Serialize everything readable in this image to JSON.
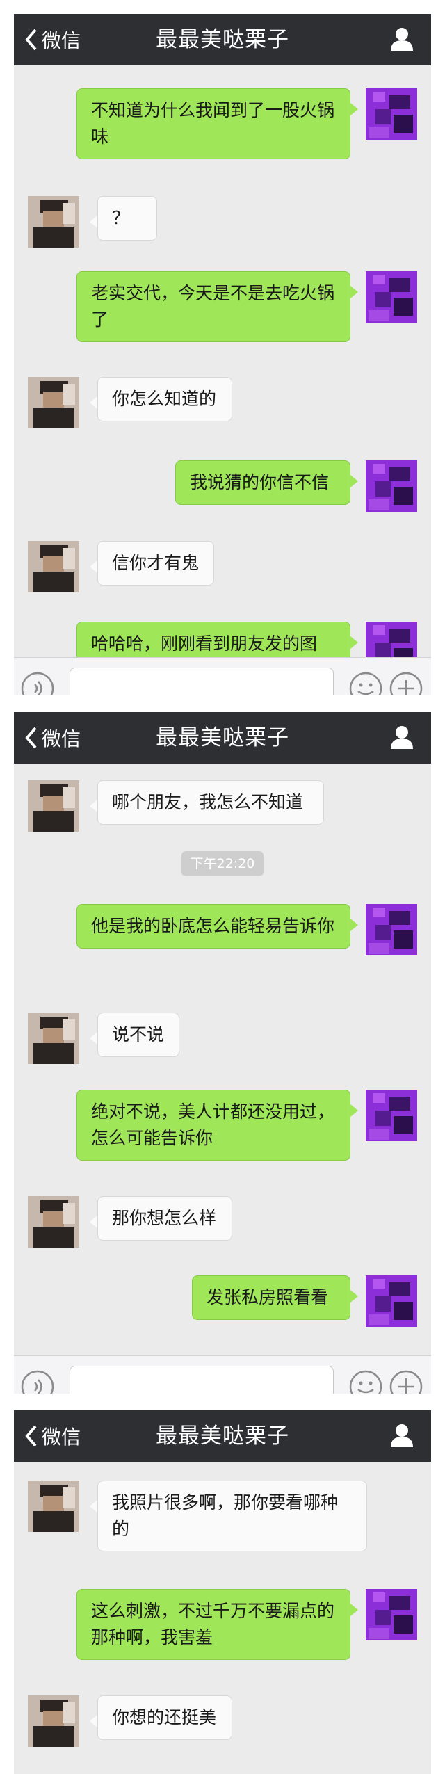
{
  "app": {
    "back_label": "微信",
    "chat_title": "最最美哒栗子"
  },
  "timestamp": "下午22:20",
  "messages": {
    "p1": [
      {
        "from": "me",
        "text": "不知道为什么我闻到了一股火锅味"
      },
      {
        "from": "them",
        "text": "？"
      },
      {
        "from": "me",
        "text": "老实交代，今天是不是去吃火锅了"
      },
      {
        "from": "them",
        "text": "你怎么知道的"
      },
      {
        "from": "me",
        "text": "我说猜的你信不信"
      },
      {
        "from": "them",
        "text": "信你才有鬼"
      },
      {
        "from": "me",
        "text": "哈哈哈，刚刚看到朋友发的图"
      }
    ],
    "p2": [
      {
        "from": "them",
        "text": "哪个朋友，我怎么不知道"
      },
      {
        "from": "me",
        "text": "他是我的卧底怎么能轻易告诉你"
      },
      {
        "from": "them",
        "text": "说不说"
      },
      {
        "from": "me",
        "text": "绝对不说，美人计都还没用过，怎么可能告诉你"
      },
      {
        "from": "them",
        "text": "那你想怎么样"
      },
      {
        "from": "me",
        "text": "发张私房照看看"
      }
    ],
    "p3": [
      {
        "from": "them",
        "text": "我照片很多啊，那你要看哪种的"
      },
      {
        "from": "me",
        "text": "这么刺激，不过千万不要漏点的那种啊，我害羞"
      },
      {
        "from": "them",
        "text": "你想的还挺美"
      }
    ]
  },
  "icons": {
    "back": "chevron-left-icon",
    "profile": "person-icon",
    "voice": "voice-icon",
    "emoji": "emoji-icon",
    "more": "plus-icon"
  },
  "colors": {
    "header_bg": "#2e2f33",
    "chat_bg": "#ebebeb",
    "outgoing_bubble": "#9fe658",
    "incoming_bubble": "#fafafa"
  }
}
